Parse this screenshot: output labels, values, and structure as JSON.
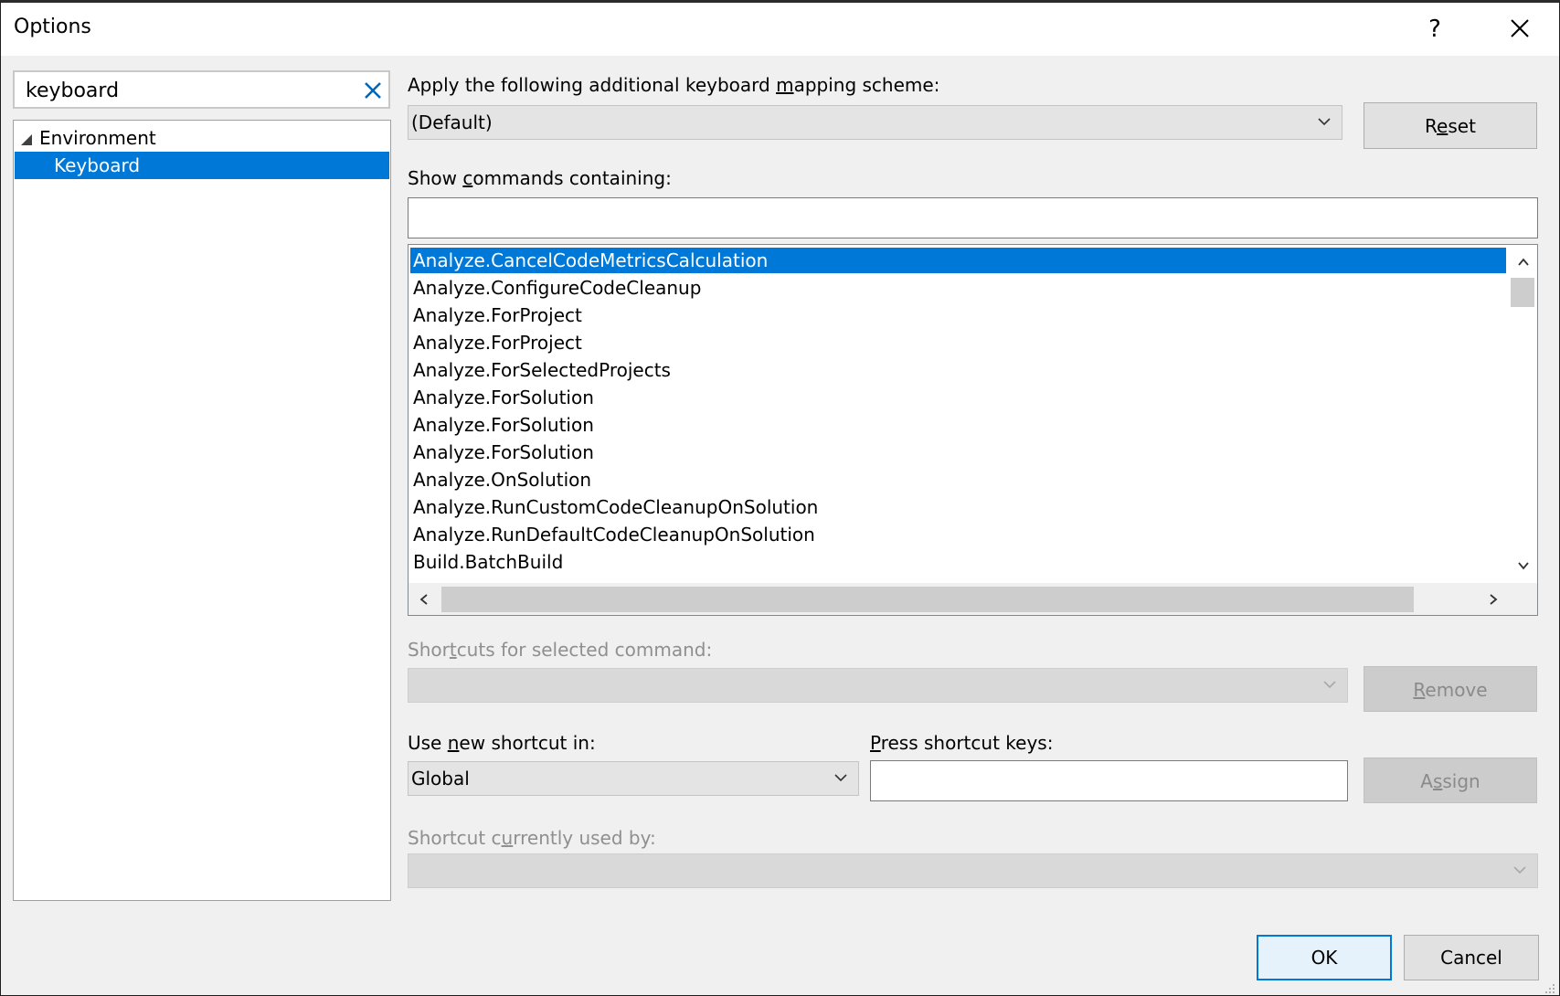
{
  "window": {
    "title": "Options",
    "help_label": "?"
  },
  "search": {
    "value": "keyboard",
    "placeholder": ""
  },
  "tree": {
    "items": [
      {
        "label": "Environment",
        "expanded": true
      },
      {
        "label": "Keyboard",
        "selected": true
      }
    ]
  },
  "mapping": {
    "label_pre": "Apply the following additional keyboard ",
    "label_accel": "m",
    "label_post": "apping scheme:",
    "selected": "(Default)",
    "reset_pre": "R",
    "reset_accel": "e",
    "reset_post": "set"
  },
  "commands": {
    "label_pre": "Show ",
    "label_accel": "c",
    "label_post": "ommands containing:",
    "filter_value": "",
    "items": [
      "Analyze.CancelCodeMetricsCalculation",
      "Analyze.ConfigureCodeCleanup",
      "Analyze.ForProject",
      "Analyze.ForProject",
      "Analyze.ForSelectedProjects",
      "Analyze.ForSolution",
      "Analyze.ForSolution",
      "Analyze.ForSolution",
      "Analyze.OnSolution",
      "Analyze.RunCustomCodeCleanupOnSolution",
      "Analyze.RunDefaultCodeCleanupOnSolution",
      "Build.BatchBuild"
    ],
    "selected_index": 0
  },
  "shortcuts": {
    "label_pre": "Shor",
    "label_accel": "t",
    "label_post": "cuts for selected command:",
    "value": "",
    "remove_accel": "R",
    "remove_post": "emove"
  },
  "new_shortcut": {
    "scope_label_pre": "Use ",
    "scope_label_accel": "n",
    "scope_label_post": "ew shortcut in:",
    "scope_value": "Global",
    "press_label_accel": "P",
    "press_label_post": "ress shortcut keys:",
    "press_value": "",
    "assign_pre": "A",
    "assign_accel": "s",
    "assign_post": "sign"
  },
  "used_by": {
    "label_pre": "Shortcut c",
    "label_accel": "u",
    "label_post": "rrently used by:",
    "value": ""
  },
  "footer": {
    "ok_label": "OK",
    "cancel_label": "Cancel"
  },
  "colors": {
    "accent": "#0078d7",
    "dialog_bg": "#f0f0f0",
    "disabled_text": "#8f8f8f"
  }
}
